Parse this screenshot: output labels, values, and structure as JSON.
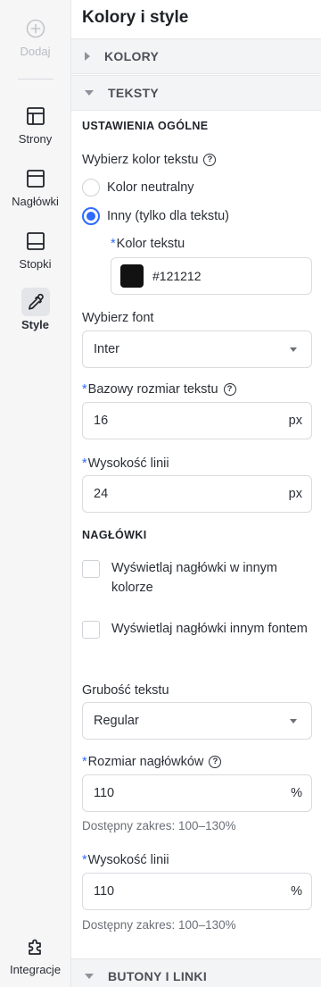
{
  "rail": {
    "add": "Dodaj",
    "pages": "Strony",
    "headers": "Nagłówki",
    "footers": "Stopki",
    "style": "Style",
    "integrations": "Integracje"
  },
  "panel": {
    "title": "Kolory i style",
    "accordion_colors": "KOLORY",
    "accordion_texts": "TEKSTY",
    "accordion_buttons": "BUTONY I LINKI"
  },
  "general": {
    "heading": "USTAWIENIA OGÓLNE",
    "choose_color_label": "Wybierz kolor tekstu",
    "radio_neutral": "Kolor neutralny",
    "radio_other": "Inny (tylko dla tekstu)",
    "text_color_label": "Kolor tekstu",
    "text_color_value": "#121212",
    "text_color_hex": "#121212",
    "choose_font_label": "Wybierz font",
    "font_value": "Inter",
    "base_size_label": "Bazowy rozmiar tekstu",
    "base_size_value": "16",
    "base_size_unit": "px",
    "line_height_label": "Wysokość linii",
    "line_height_value": "24",
    "line_height_unit": "px"
  },
  "headings": {
    "heading": "NAGŁÓWKI",
    "cb_other_color": "Wyświetlaj nagłówki w innym kolorze",
    "cb_other_font": "Wyświetlaj nagłówki innym fontem",
    "weight_label": "Grubość tekstu",
    "weight_value": "Regular",
    "size_label": "Rozmiar nagłówków",
    "size_value": "110",
    "size_unit": "%",
    "size_hint": "Dostępny zakres: 100–130%",
    "lh_label": "Wysokość linii",
    "lh_value": "110",
    "lh_unit": "%",
    "lh_hint": "Dostępny zakres: 100–130%"
  },
  "required_mark": "*",
  "help_glyph": "?",
  "colors": {
    "accent": "#2f6bff",
    "rail_bg": "#f6f6f7",
    "accordion_bg": "#f3f4f5"
  }
}
